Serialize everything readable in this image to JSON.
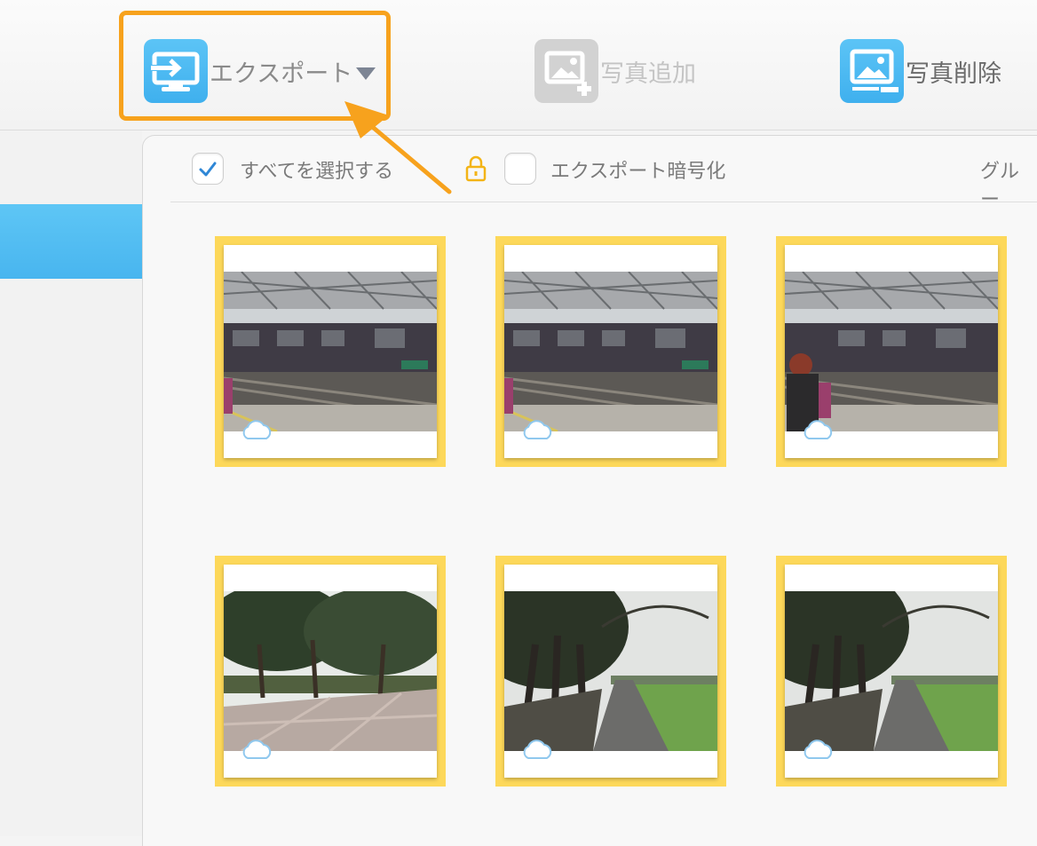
{
  "toolbar": {
    "export_label": "エクスポート",
    "add_photo_label": "写真追加",
    "delete_photo_label": "写真削除"
  },
  "options": {
    "select_all_label": "すべてを選択する",
    "select_all_checked": true,
    "encrypt_label": "エクスポート暗号化",
    "encrypt_checked": false,
    "group_label": "グルー"
  },
  "photos": [
    {
      "scene": "train-station"
    },
    {
      "scene": "train-station"
    },
    {
      "scene": "train-station-person"
    },
    {
      "scene": "park-trees"
    },
    {
      "scene": "tree-path"
    },
    {
      "scene": "tree-path"
    }
  ],
  "colors": {
    "accent_orange": "#f7a21d",
    "selection_yellow": "#fdd85a",
    "icon_blue": "#4fbaf2",
    "sidebar_selected": "#50bbf1"
  }
}
